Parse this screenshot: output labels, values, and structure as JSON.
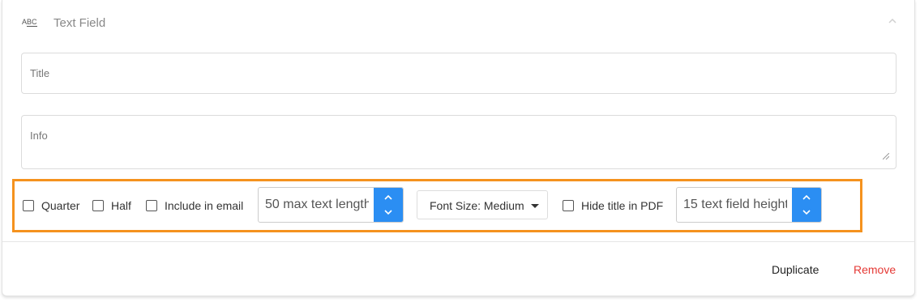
{
  "header": {
    "icon": "text-abc-icon",
    "icon_text_a": "A",
    "icon_text_bc": "BC",
    "title": "Text Field",
    "collapse_icon": "chevron-up-icon"
  },
  "fields": {
    "title_placeholder": "Title",
    "info_placeholder": "Info"
  },
  "options": {
    "quarter_label": "Quarter",
    "half_label": "Half",
    "include_email_label": "Include in email",
    "max_text_length": "50 max text length",
    "font_size_label": "Font Size: Medium",
    "hide_title_label": "Hide title in PDF",
    "text_field_height": "15 text field height",
    "quarter_checked": false,
    "half_checked": false,
    "include_email_checked": false,
    "hide_title_checked": false
  },
  "footer": {
    "duplicate_label": "Duplicate",
    "remove_label": "Remove"
  },
  "colors": {
    "highlight_border": "#f5921e",
    "spinner_button": "#2b8ef3",
    "remove_text": "#e53935"
  }
}
